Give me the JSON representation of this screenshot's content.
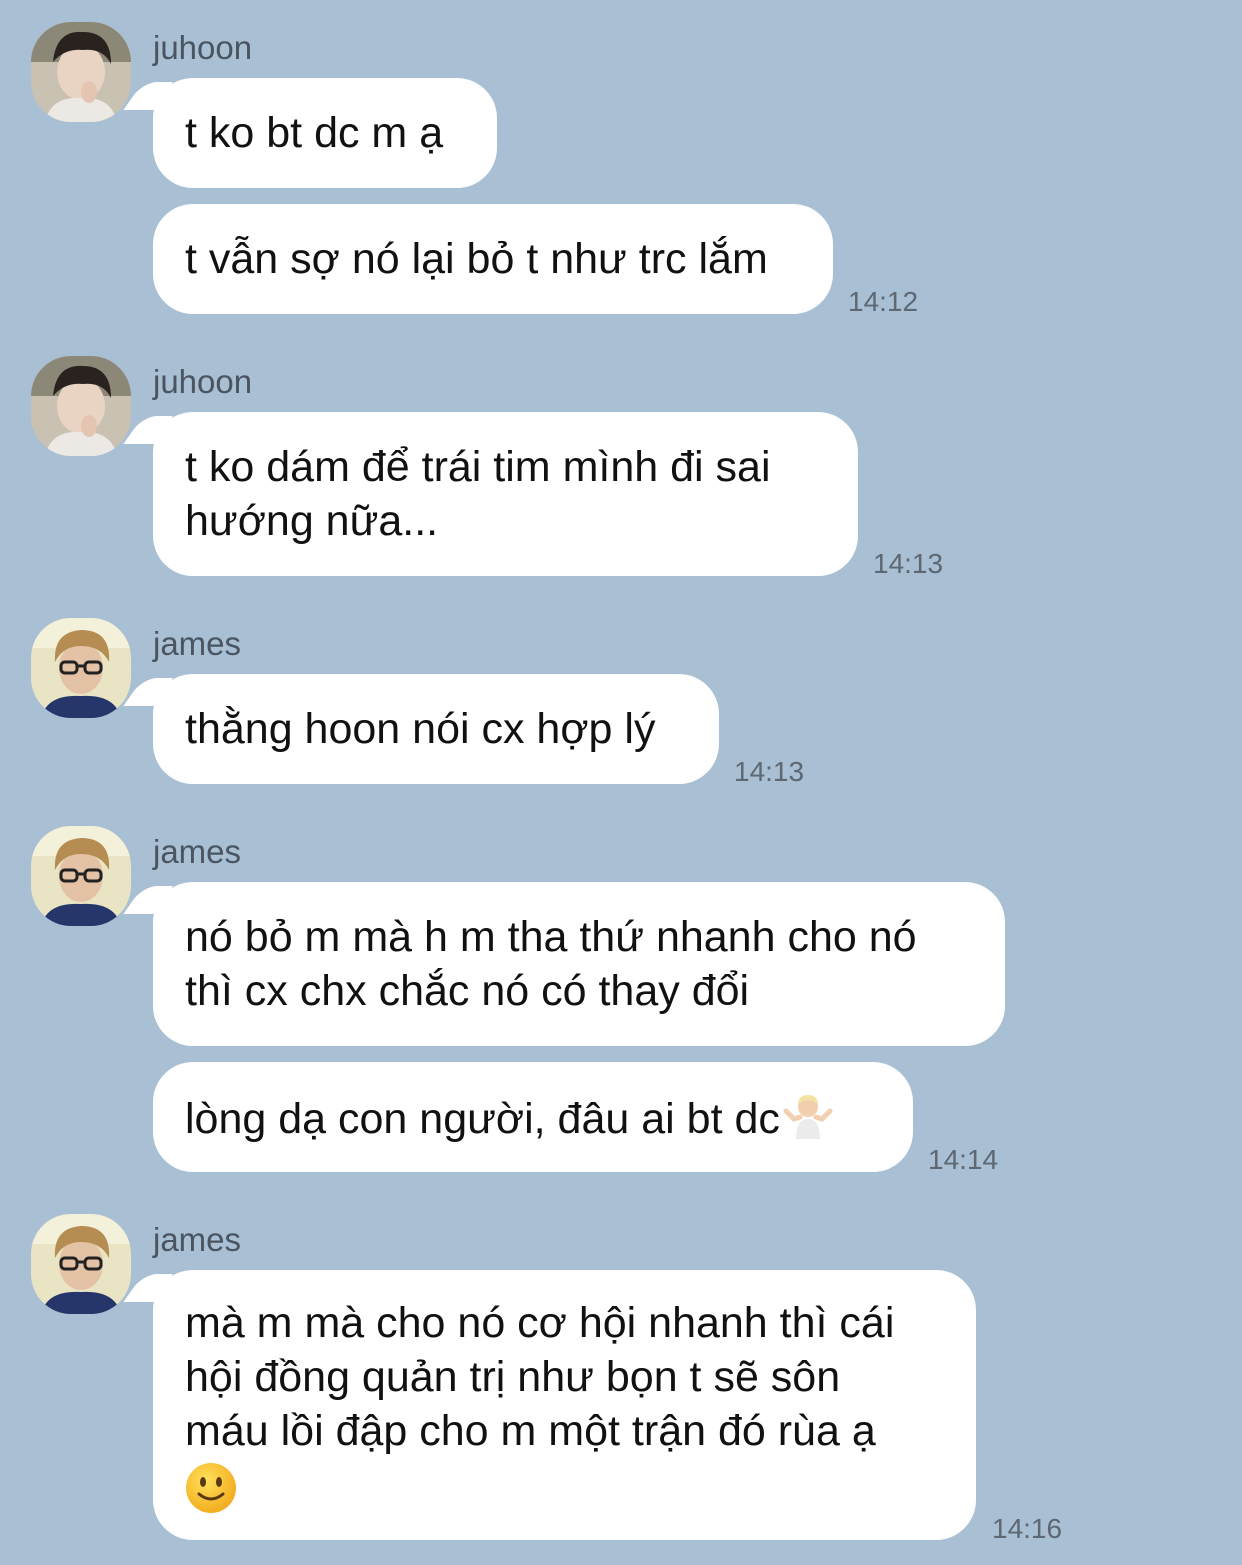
{
  "colors": {
    "background": "#a9bfd3",
    "bubble": "#ffffff",
    "text": "#111111",
    "sender": "#4a5561",
    "timestamp": "#5d6873"
  },
  "messages": [
    {
      "sender": "juhoon",
      "avatar": "juhoon-avatar",
      "bubbles": [
        {
          "lines": [
            "t ko bt dc m ạ"
          ]
        },
        {
          "lines": [
            "t vẫn sợ nó lại bỏ t như trc lắm"
          ]
        }
      ],
      "time": "14:12"
    },
    {
      "sender": "juhoon",
      "avatar": "juhoon-avatar",
      "bubbles": [
        {
          "lines": [
            "t ko dám để trái tim mình đi sai",
            "hướng nữa..."
          ]
        }
      ],
      "time": "14:13"
    },
    {
      "sender": "james",
      "avatar": "james-avatar",
      "bubbles": [
        {
          "lines": [
            "thằng hoon nói cx hợp lý"
          ]
        }
      ],
      "time": "14:13"
    },
    {
      "sender": "james",
      "avatar": "james-avatar",
      "bubbles": [
        {
          "lines": [
            "nó bỏ m mà h m tha thứ nhanh cho nó",
            "thì cx chx chắc nó có thay đổi"
          ]
        },
        {
          "lines": [
            "lòng dạ con người, đâu ai bt dc"
          ],
          "emoji": "person-shrugging-emoji"
        }
      ],
      "time": "14:14"
    },
    {
      "sender": "james",
      "avatar": "james-avatar",
      "bubbles": [
        {
          "lines": [
            "mà m mà cho nó cơ hội nhanh thì cái",
            "hội đồng quản trị như bọn t sẽ sôn",
            "máu lồi đập cho m một trận đó rùa ạ"
          ],
          "emoji": "slightly-smiling-face-emoji"
        }
      ],
      "time": "14:16"
    }
  ]
}
